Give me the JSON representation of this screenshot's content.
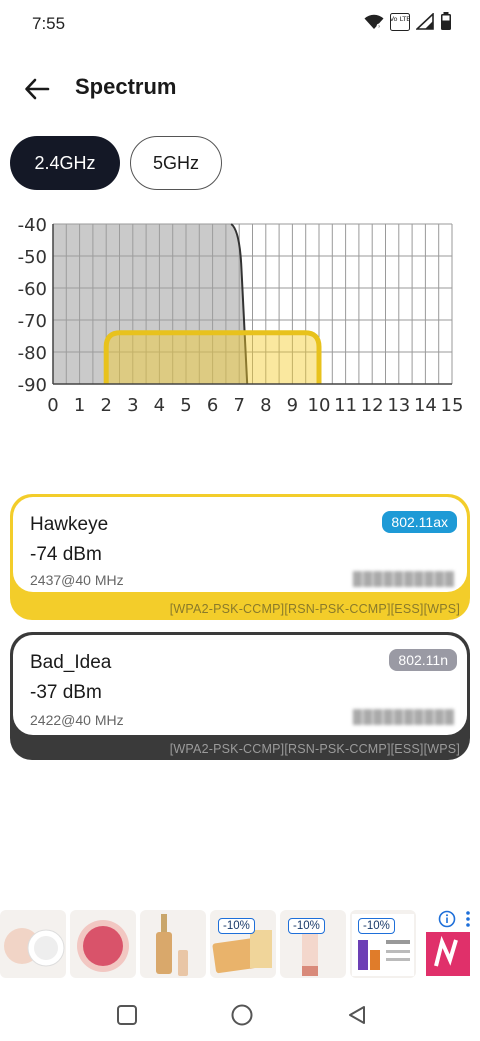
{
  "status_bar": {
    "time": "7:55",
    "icons": [
      "wifi-icon",
      "volte-icon",
      "signal-icon",
      "battery-icon"
    ],
    "volte_text": "Vo LTE"
  },
  "app_bar": {
    "title": "Spectrum",
    "back_icon": "arrow-left-icon"
  },
  "band_tabs": [
    {
      "label": "2.4GHz",
      "selected": true
    },
    {
      "label": "5GHz",
      "selected": false
    }
  ],
  "chart_data": {
    "type": "area",
    "x_ticks": [
      "0",
      "1",
      "2",
      "3",
      "4",
      "5",
      "6",
      "7",
      "8",
      "9",
      "10",
      "11",
      "12",
      "13",
      "14",
      "15"
    ],
    "y_ticks": [
      "-40",
      "-50",
      "-60",
      "-70",
      "-80",
      "-90"
    ],
    "xlim": [
      0,
      15
    ],
    "ylim": [
      -90,
      -40
    ],
    "grid": true,
    "series": [
      {
        "ssid": "Bad_Idea",
        "peak_dbm": -37,
        "x_from": 0,
        "x_to": 7,
        "fill": "#9e9e9e",
        "stroke": "#333333"
      },
      {
        "ssid": "Hawkeye",
        "peak_dbm": -74,
        "x_from": 2,
        "x_to": 10,
        "fill": "#f3cd2a",
        "stroke": "#e8c21c"
      }
    ]
  },
  "networks": [
    {
      "ssid": "Hawkeye",
      "rssi": "-74 dBm",
      "freq": "2437@40 MHz",
      "standard": "802.11ax",
      "bssid_obscured": "██████████",
      "capabilities": "[WPA2-PSK-CCMP][RSN-PSK-CCMP][ESS][WPS]",
      "accent": "#f3cd2a",
      "badge_color": "#1e9ad6"
    },
    {
      "ssid": "Bad_Idea",
      "rssi": "-37 dBm",
      "freq": "2422@40 MHz",
      "standard": "802.11n",
      "bssid_obscured": "██████████",
      "capabilities": "[WPA2-PSK-CCMP][RSN-PSK-CCMP][ESS][WPS]",
      "accent": "#3a3a3a",
      "badge_color": "#9a9aa4"
    }
  ],
  "ad_strip": {
    "discount_badges": [
      "-10%",
      "-10%",
      "-10%"
    ],
    "info_icon": "info-icon",
    "more_icon": "more-vertical-icon"
  },
  "nav_bar": {
    "icons": [
      "recents-square-icon",
      "home-circle-icon",
      "back-triangle-icon"
    ]
  }
}
